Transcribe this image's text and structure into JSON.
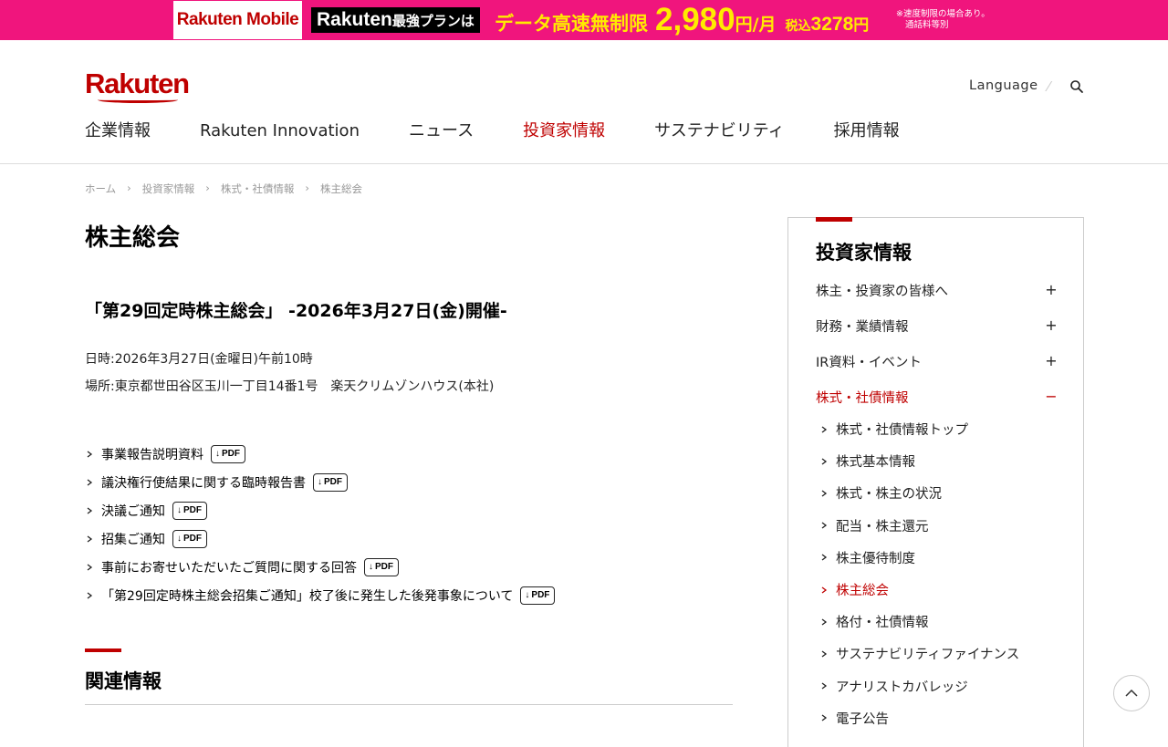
{
  "promo": {
    "brand": "Rakuten Mobile",
    "plan_prefix": "Rakuten",
    "plan_suffix": "最強プランは",
    "headline": "データ高速無制限",
    "price": "2,980",
    "price_unit": "円/月",
    "tax_label": "税込",
    "tax_price": "3278",
    "tax_unit": "円",
    "note_line1": "※速度制限の場合あり。",
    "note_line2": "通話料等別",
    "bg_color": "#f0157d",
    "accent_color": "#ffeb00"
  },
  "header": {
    "logo": "Rakuten",
    "language": "Language",
    "search_icon": "search-icon"
  },
  "gnav": [
    {
      "label": "企業情報"
    },
    {
      "label": "Rakuten Innovation"
    },
    {
      "label": "ニュース"
    },
    {
      "label": "投資家情報"
    },
    {
      "label": "サステナビリティ"
    },
    {
      "label": "採用情報"
    }
  ],
  "breadcrumb": [
    "ホーム",
    "投資家情報",
    "株式・社債情報",
    "株主総会"
  ],
  "main": {
    "title": "株主総会",
    "event_title": "「第29回定時株主総会」 -2026年3月27日(金)開催-",
    "date_line": "日時:2026年3月27日(金曜日)午前10時",
    "place_line": "場所:東京都世田谷区玉川一丁目14番1号　楽天クリムゾンハウス(本社)",
    "pdf_label": "PDF",
    "documents": [
      {
        "label": "事業報告説明資料"
      },
      {
        "label": "議決権行使結果に関する臨時報告書"
      },
      {
        "label": "決議ご通知"
      },
      {
        "label": "招集ご通知"
      },
      {
        "label": "事前にお寄せいただいたご質問に関する回答"
      },
      {
        "label": "「第29回定時株主総会招集ご通知」校了後に発生した後発事象について"
      }
    ],
    "related_title": "関連情報"
  },
  "sidebar": {
    "title": "投資家情報",
    "categories": [
      {
        "label": "株主・投資家の皆様へ",
        "toggle": "+"
      },
      {
        "label": "財務・業績情報",
        "toggle": "+"
      },
      {
        "label": "IR資料・イベント",
        "toggle": "+"
      },
      {
        "label": "株式・社債情報",
        "toggle": "−"
      }
    ],
    "sub_items": [
      {
        "label": "株式・社債情報トップ"
      },
      {
        "label": "株式基本情報"
      },
      {
        "label": "株式・株主の状況"
      },
      {
        "label": "配当・株主還元"
      },
      {
        "label": "株主優待制度"
      },
      {
        "label": "株主総会"
      },
      {
        "label": "格付・社債情報"
      },
      {
        "label": "サステナビリティファイナンス"
      },
      {
        "label": "アナリストカバレッジ"
      },
      {
        "label": "電子公告"
      }
    ]
  },
  "colors": {
    "brand": "#bf0000",
    "text": "#222222",
    "muted": "#999999"
  }
}
